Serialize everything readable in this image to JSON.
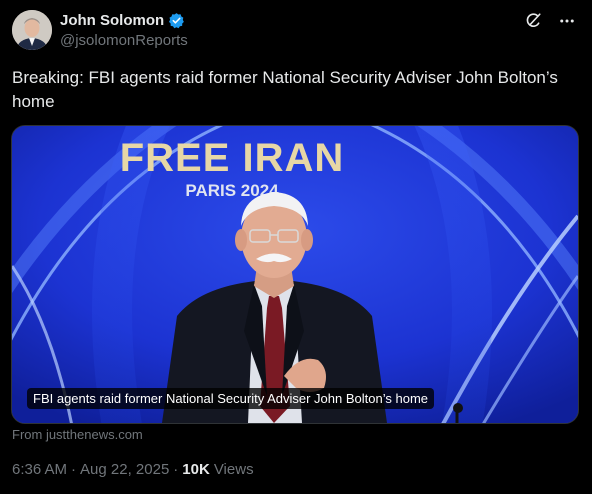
{
  "author": {
    "display_name": "John Solomon",
    "handle": "@jsolomonReports",
    "verified": true
  },
  "header_icons": [
    "grok-icon",
    "more-icon"
  ],
  "tweet": {
    "text": "Breaking: FBI agents raid former National Security Adviser John Bolton’s home"
  },
  "media": {
    "sign_text": "FREE IRAN",
    "sign_subtext": "PARIS 2024",
    "caption": "FBI agents raid former National Security Adviser John Bolton’s home"
  },
  "card": {
    "source": "From justthenews.com"
  },
  "meta": {
    "time": "6:36 AM",
    "sep1": "·",
    "date": "Aug 22, 2025",
    "sep2": "·",
    "views_count": "10K",
    "views_label": "Views"
  },
  "colors": {
    "background": "#000000",
    "text": "#e7e9ea",
    "muted": "#71767b",
    "verified_blue": "#1d9bf0",
    "stage_blue": "#1a2fd0"
  }
}
